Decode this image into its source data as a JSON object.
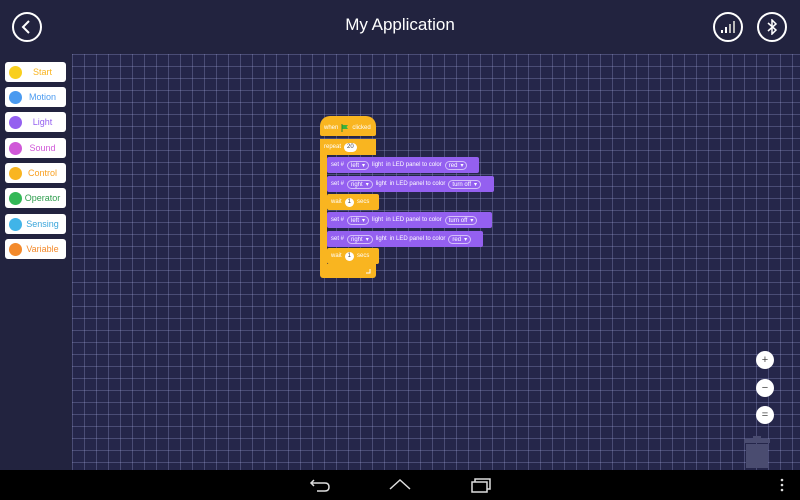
{
  "header": {
    "title": "My Application"
  },
  "palette": [
    {
      "label": "Start",
      "color": "#f9cf1e",
      "text_color": "#f9b520"
    },
    {
      "label": "Motion",
      "color": "#4a9af0",
      "text_color": "#4a9af0"
    },
    {
      "label": "Light",
      "color": "#9460f0",
      "text_color": "#9460f0"
    },
    {
      "label": "Sound",
      "color": "#d058d8",
      "text_color": "#d058d8"
    },
    {
      "label": "Control",
      "color": "#f9b520",
      "text_color": "#f9a020"
    },
    {
      "label": "Operator",
      "color": "#33b857",
      "text_color": "#2f9e4e"
    },
    {
      "label": "Sensing",
      "color": "#40b4e8",
      "text_color": "#3aa6db"
    },
    {
      "label": "Variable",
      "color": "#f38a2c",
      "text_color": "#f38a2c"
    }
  ],
  "blocks": {
    "hat": {
      "when": "when",
      "clicked": "clicked"
    },
    "repeat": {
      "label": "repeat",
      "count": "20"
    },
    "set1": {
      "set": "set #",
      "side": "left",
      "text1": "light",
      "text2": "in LED panel to color",
      "color": "red"
    },
    "set2": {
      "set": "set #",
      "side": "right",
      "text1": "light",
      "text2": "in LED panel to color",
      "color": "turn off"
    },
    "wait1": {
      "wait": "wait",
      "value": "1",
      "unit": "secs"
    },
    "set3": {
      "set": "set #",
      "side": "left",
      "text1": "light",
      "text2": "in LED panel to color",
      "color": "turn off"
    },
    "set4": {
      "set": "set #",
      "side": "right",
      "text1": "light",
      "text2": "in LED panel to color",
      "color": "red"
    },
    "wait2": {
      "wait": "wait",
      "value": "1",
      "unit": "secs"
    }
  },
  "zoom": {
    "in": "+",
    "out": "−",
    "reset": "="
  }
}
